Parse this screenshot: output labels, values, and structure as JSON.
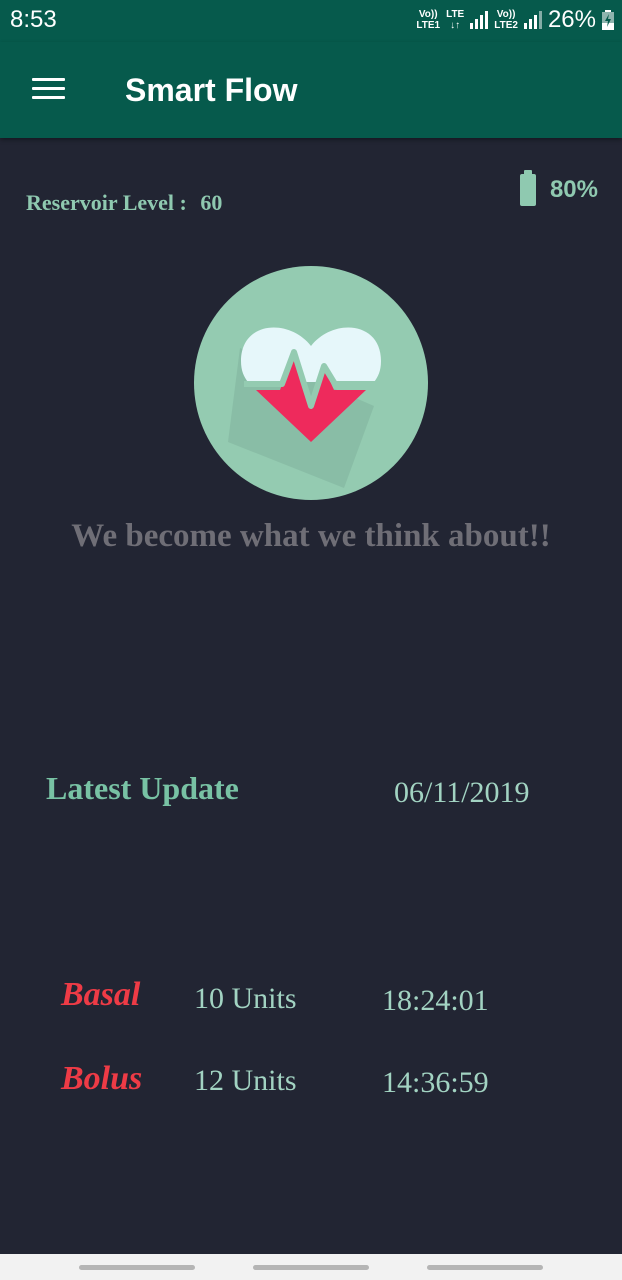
{
  "status_bar": {
    "time": "8:53",
    "sim1_top": "Vo))",
    "sim1_bottom": "LTE1",
    "lte_top": "LTE",
    "lte_bottom": "↓↑",
    "sim2_top": "Vo))",
    "sim2_bottom": "LTE2",
    "battery_percent": "26%"
  },
  "app_bar": {
    "title": "Smart Flow"
  },
  "reservoir": {
    "label": "Reservoir Level :",
    "value": "60"
  },
  "battery": {
    "percent": "80%"
  },
  "quote": "We become what we think about!!",
  "latest_update": {
    "label": "Latest Update",
    "date": "06/11/2019"
  },
  "records": [
    {
      "type": "Basal",
      "units": "10 Units",
      "time": "18:24:01"
    },
    {
      "type": "Bolus",
      "units": "12 Units",
      "time": "14:36:59"
    }
  ],
  "colors": {
    "background": "#222533",
    "app_bar": "#065a4c",
    "accent_green": "#8fc9b0",
    "record_type_red": "#ee3b46",
    "heart_red": "#ee2a5c",
    "logo_circle": "#94cbb1"
  }
}
